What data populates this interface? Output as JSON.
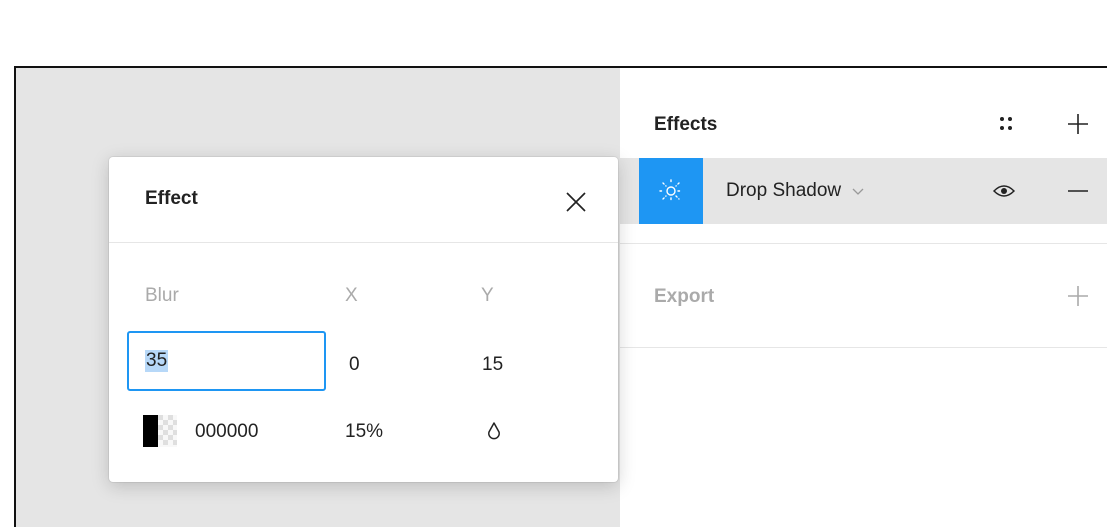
{
  "panel": {
    "effects_title": "Effects",
    "effect_item": {
      "name": "Drop Shadow",
      "accent_color": "#1e96f3",
      "visible": true
    },
    "export_title": "Export"
  },
  "popup": {
    "title": "Effect",
    "labels": {
      "blur": "Blur",
      "x": "X",
      "y": "Y"
    },
    "values": {
      "blur": "35",
      "x": "0",
      "y": "15"
    },
    "color": {
      "hex": "000000",
      "opacity": "15%"
    }
  },
  "icons": [
    "grid-icon",
    "plus-icon",
    "sun-icon",
    "chevron-down-icon",
    "eye-icon",
    "minus-icon",
    "close-icon",
    "drop-icon"
  ]
}
